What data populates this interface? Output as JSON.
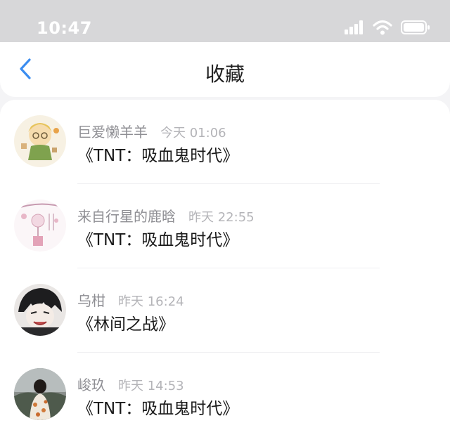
{
  "status_bar": {
    "time": "10:47",
    "icons": [
      "signal-icon",
      "wifi-icon",
      "battery-icon"
    ]
  },
  "header": {
    "back_icon": "chevron-left-icon",
    "title": "收藏"
  },
  "favorites": [
    {
      "user": "巨爱懒羊羊",
      "time": "今天 01:06",
      "title": "《TNT：吸血鬼时代》"
    },
    {
      "user": "来自行星的鹿晗",
      "time": "昨天 22:55",
      "title": "《TNT：吸血鬼时代》"
    },
    {
      "user": "乌柑",
      "time": "昨天 16:24",
      "title": "《林间之战》"
    },
    {
      "user": "峻玖",
      "time": "昨天 14:53",
      "title": "《TNT：吸血鬼时代》"
    }
  ],
  "colors": {
    "accent": "#3b8df0",
    "status_bar_bg": "#d7d7d9",
    "page_bg": "#f4f4f6"
  }
}
